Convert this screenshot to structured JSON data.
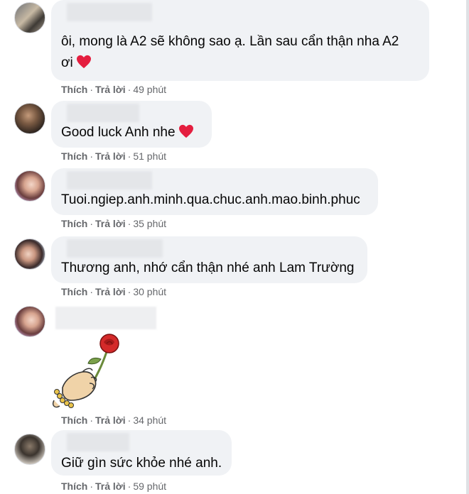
{
  "comments": [
    {
      "text1": "ôi, mong là A2 sẽ không sao ạ. Lần sau cẩn thận nha A2",
      "text2": "ơi",
      "like": "Thích",
      "reply": "Trả lời",
      "time": "49 phút"
    },
    {
      "text1": "Good luck Anh nhe",
      "like": "Thích",
      "reply": "Trả lời",
      "time": "51 phút"
    },
    {
      "text1": "Tuoi.ngiep.anh.minh.qua.chuc.anh.mao.binh.phuc",
      "like": "Thích",
      "reply": "Trả lời",
      "time": "35 phút"
    },
    {
      "text1": "Thương anh, nhớ cẩn thận nhé anh Lam Trường",
      "like": "Thích",
      "reply": "Trả lời",
      "time": "30 phút"
    },
    {
      "sticker": "rose-in-hand-sticker",
      "like": "Thích",
      "reply": "Trả lời",
      "time": "34 phút"
    },
    {
      "text1": "Giữ gìn sức khỏe nhé anh.",
      "like": "Thích",
      "reply": "Trả lời",
      "time": "59 phút"
    }
  ],
  "colors": {
    "bubble": "#f0f2f5",
    "meta": "#65676b",
    "heart": "#e41e3f",
    "rose": "#d42a2a"
  }
}
